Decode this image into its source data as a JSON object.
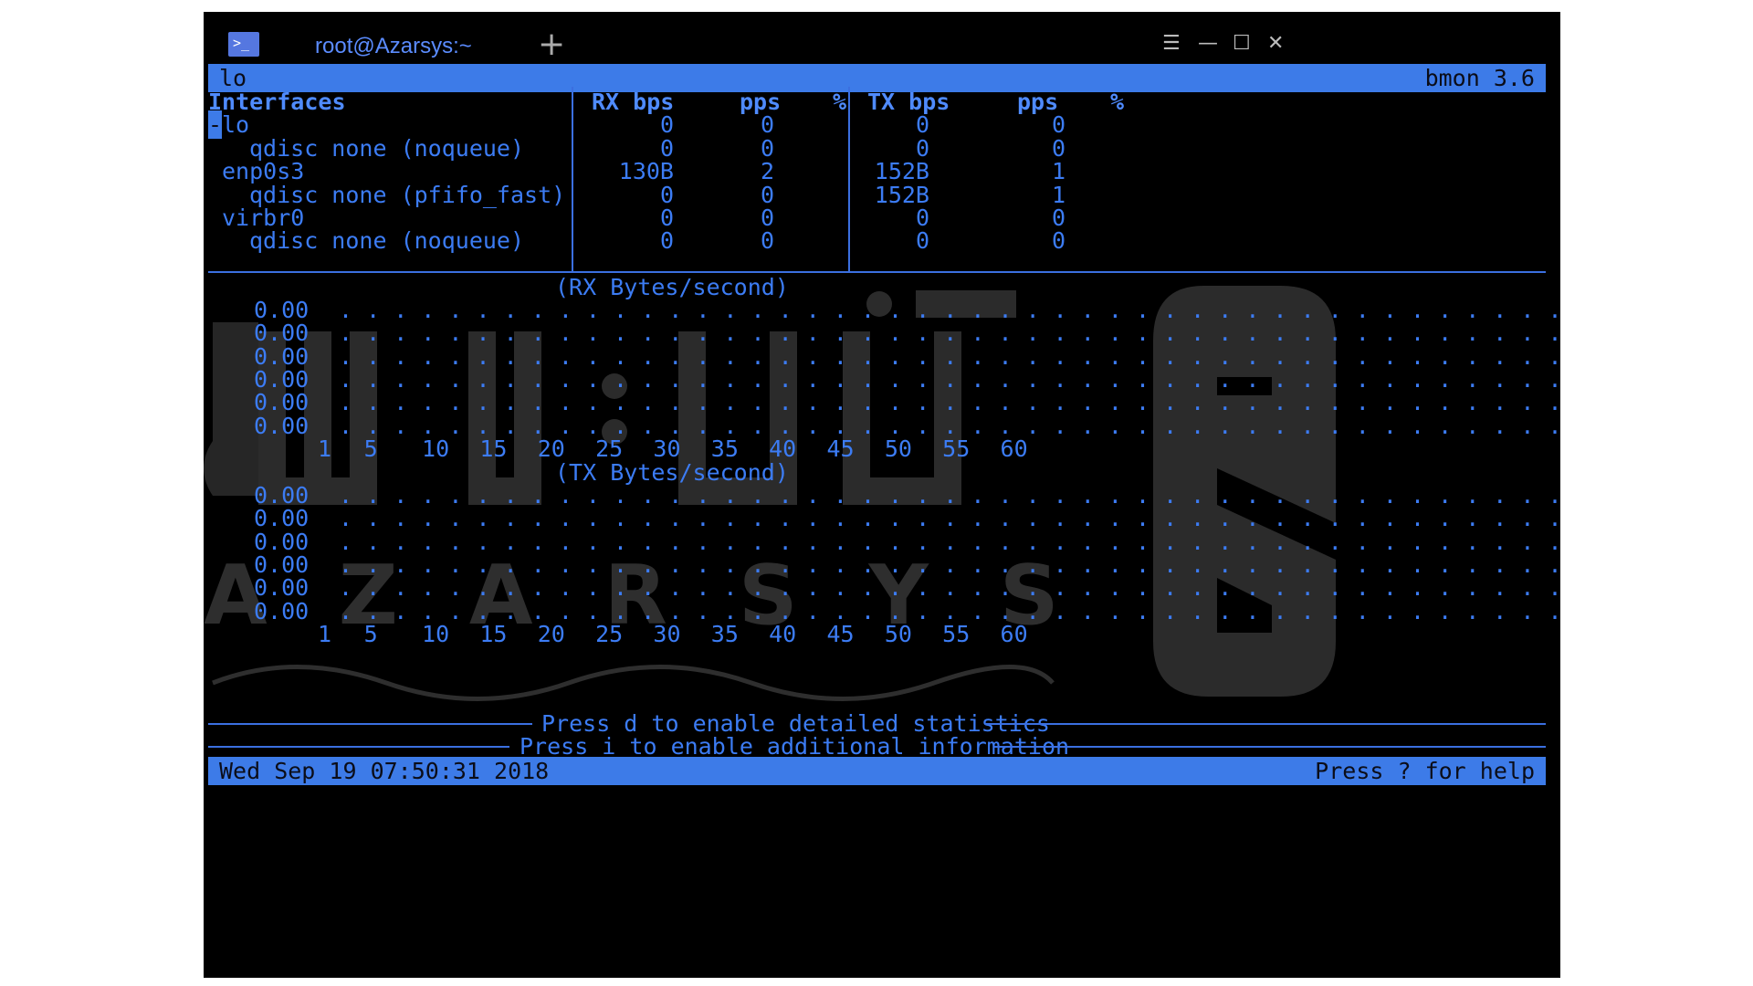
{
  "window": {
    "tab_title": "root@Azarsys:~",
    "app_icon_text": ">_",
    "new_tab_symbol": "+",
    "controls": {
      "menu": "☰",
      "minimize": "—",
      "maximize": "☐",
      "close": "✕"
    }
  },
  "top_bar": {
    "interface": "lo",
    "app": "bmon 3.6"
  },
  "table": {
    "headers": {
      "interfaces": "Interfaces",
      "rx_bps": "RX bps",
      "rx_pps": "pps",
      "rx_pct": "%",
      "tx_bps": "TX bps",
      "tx_pps": "pps",
      "tx_pct": "%"
    },
    "rows": [
      {
        "name": "lo",
        "rx_bps": "0",
        "rx_pps": "0",
        "tx_bps": "0",
        "tx_pps": "0"
      },
      {
        "name": "qdisc none (noqueue)",
        "rx_bps": "0",
        "rx_pps": "0",
        "tx_bps": "0",
        "tx_pps": "0"
      },
      {
        "name": "enp0s3",
        "rx_bps": "130B",
        "rx_pps": "2",
        "tx_bps": "152B",
        "tx_pps": "1"
      },
      {
        "name": "qdisc none (pfifo_fast)",
        "rx_bps": "0",
        "rx_pps": "0",
        "tx_bps": "152B",
        "tx_pps": "1"
      },
      {
        "name": "virbr0",
        "rx_bps": "0",
        "rx_pps": "0",
        "tx_bps": "0",
        "tx_pps": "0"
      },
      {
        "name": "qdisc none (noqueue)",
        "rx_bps": "0",
        "rx_pps": "0",
        "tx_bps": "0",
        "tx_pps": "0"
      }
    ]
  },
  "rx_graph": {
    "title": "(RX Bytes/second)",
    "y_labels": [
      "0.00",
      "0.00",
      "0.00",
      "0.00",
      "0.00",
      "0.00"
    ],
    "x_labels": [
      "1",
      "5",
      "10",
      "15",
      "20",
      "25",
      "30",
      "35",
      "40",
      "45",
      "50",
      "55",
      "60"
    ]
  },
  "tx_graph": {
    "title": "(TX Bytes/second)",
    "y_labels": [
      "0.00",
      "0.00",
      "0.00",
      "0.00",
      "0.00",
      "0.00"
    ],
    "x_labels": [
      "1",
      "5",
      "10",
      "15",
      "20",
      "25",
      "30",
      "35",
      "40",
      "45",
      "50",
      "55",
      "60"
    ]
  },
  "footer": {
    "hint_detailed": "Press d to enable detailed statistics",
    "hint_info": "Press i to enable additional information",
    "datetime": "Wed Sep 19 07:50:31 2018",
    "help": "Press ? for help"
  },
  "watermark": {
    "brand": "AZARSYS"
  },
  "colors": {
    "accent": "#3d7be8",
    "text": "#3c7cf4",
    "background": "#000000"
  }
}
